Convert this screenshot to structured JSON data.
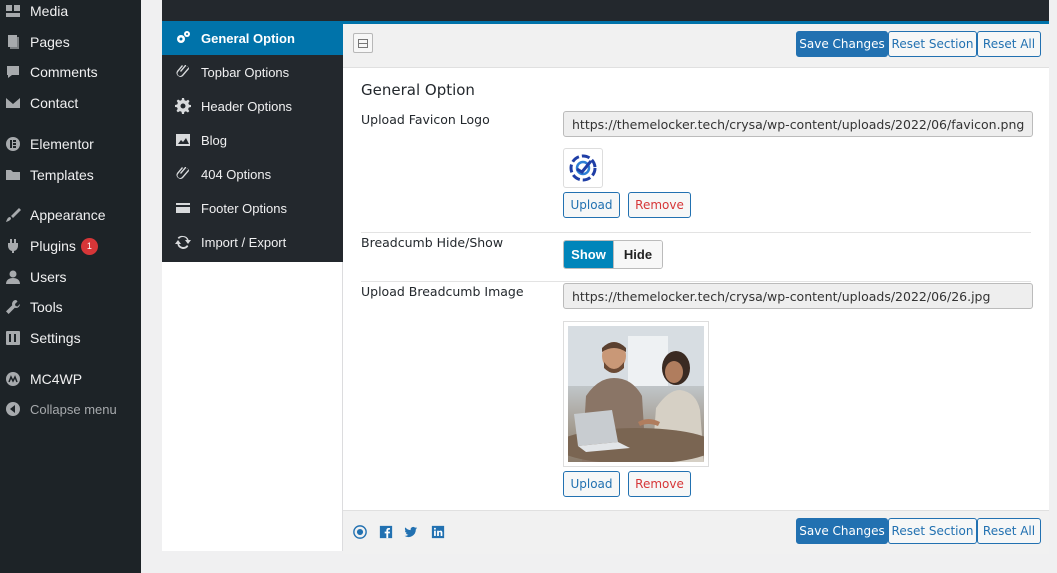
{
  "wp_menu": {
    "items": [
      {
        "label": "Media",
        "icon": "media-icon"
      },
      {
        "label": "Pages",
        "icon": "pages-icon"
      },
      {
        "label": "Comments",
        "icon": "comments-icon"
      },
      {
        "label": "Contact",
        "icon": "contact-icon"
      },
      {
        "label": "Elementor",
        "icon": "elementor-icon"
      },
      {
        "label": "Templates",
        "icon": "folder-icon"
      },
      {
        "label": "Appearance",
        "icon": "brush-icon"
      },
      {
        "label": "Plugins",
        "icon": "plug-icon",
        "badge": "1"
      },
      {
        "label": "Users",
        "icon": "user-icon"
      },
      {
        "label": "Tools",
        "icon": "wrench-icon"
      },
      {
        "label": "Settings",
        "icon": "settings-icon"
      },
      {
        "label": "MC4WP",
        "icon": "mc4wp-icon"
      },
      {
        "label": "Collapse menu",
        "icon": "collapse-icon"
      }
    ]
  },
  "options_nav": {
    "items": [
      {
        "label": "General Option",
        "icon": "gears-icon",
        "active": true
      },
      {
        "label": "Topbar Options",
        "icon": "paperclip-icon"
      },
      {
        "label": "Header Options",
        "icon": "gear-icon"
      },
      {
        "label": "Blog",
        "icon": "image-icon"
      },
      {
        "label": "404 Options",
        "icon": "paperclip-icon"
      },
      {
        "label": "Footer Options",
        "icon": "card-icon"
      },
      {
        "label": "Import / Export",
        "icon": "refresh-icon"
      }
    ]
  },
  "toolbar": {
    "save_label": "Save Changes",
    "reset_section_label": "Reset Section",
    "reset_all_label": "Reset All"
  },
  "section": {
    "title": "General Option",
    "favicon": {
      "label": "Upload Favicon Logo",
      "url": "https://themelocker.tech/crysa/wp-content/uploads/2022/06/favicon.png",
      "upload_label": "Upload",
      "remove_label": "Remove"
    },
    "breadcrumb_toggle": {
      "label": "Breadcumb Hide/Show",
      "show_label": "Show",
      "hide_label": "Hide",
      "selected": "Show"
    },
    "breadcrumb_image": {
      "label": "Upload Breadcumb Image",
      "url": "https://themelocker.tech/crysa/wp-content/uploads/2022/06/26.jpg",
      "upload_label": "Upload",
      "remove_label": "Remove"
    }
  },
  "footer_social": [
    "github-icon",
    "facebook-icon",
    "twitter-icon",
    "linkedin-icon"
  ],
  "colors": {
    "admin_bg": "#1d2327",
    "accent": "#0073aa",
    "button_primary": "#2271b1",
    "remove_text": "#d63638",
    "badge": "#d63638"
  }
}
